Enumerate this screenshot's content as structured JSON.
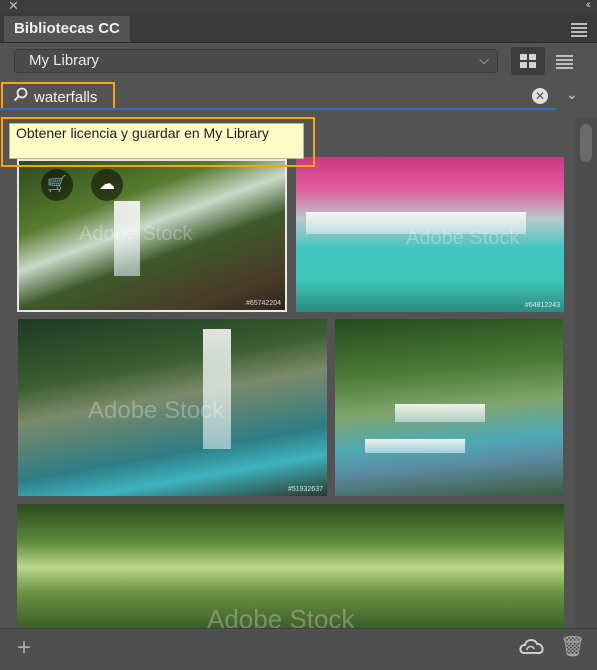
{
  "panel": {
    "title": "Bibliotecas CC",
    "close_glyph": "✕",
    "collapse_glyph": "‹‹",
    "menu_icon": "hamburger-menu-icon"
  },
  "library": {
    "selected": "My Library",
    "chevron": "⌵"
  },
  "view_toggle": {
    "active": "grid"
  },
  "search": {
    "value": "waterfalls",
    "placeholder": "",
    "clear_glyph": "✕",
    "expand_glyph": "⌄",
    "icon_glyph": "⌕"
  },
  "tooltip": {
    "text": "Obtener licencia y guardar en My Library"
  },
  "results": [
    {
      "watermark": "Adobe Stock",
      "id": "#65742204"
    },
    {
      "watermark": "Adobe Stock",
      "id": "#64812243"
    },
    {
      "watermark": "Adobe Stock",
      "id": "#51932637"
    },
    {
      "watermark": "",
      "id": ""
    },
    {
      "watermark": "Adobe Stock",
      "id": ""
    }
  ],
  "overlay_actions": {
    "license": "🛒",
    "save": "☁"
  },
  "footer": {
    "add": "+",
    "trash": "🗑"
  }
}
